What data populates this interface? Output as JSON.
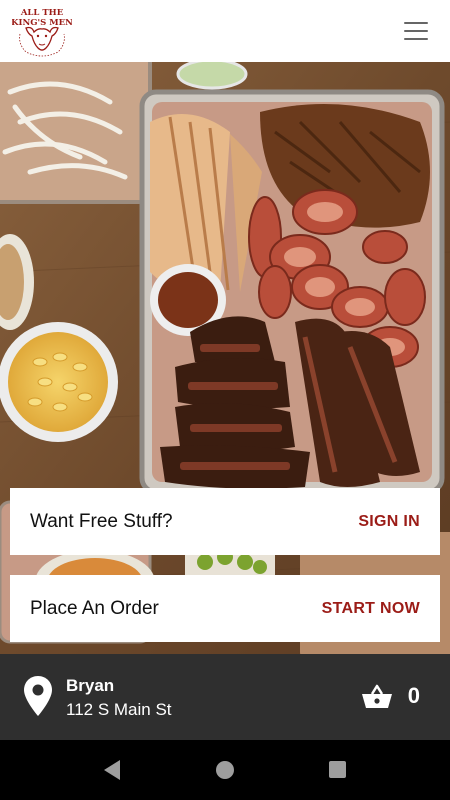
{
  "brand": {
    "logo_text_line1": "ALL THE",
    "logo_text_line2": "KING'S MEN",
    "accent_color": "#9b1c17"
  },
  "header": {
    "menu_icon": "hamburger-menu-icon"
  },
  "cards": [
    {
      "title": "Want Free Stuff?",
      "action": "SIGN IN"
    },
    {
      "title": "Place An Order",
      "action": "START NOW"
    }
  ],
  "location": {
    "icon": "location-pin-icon",
    "name": "Bryan",
    "address": "112 S Main St"
  },
  "cart": {
    "icon": "basket-icon",
    "count": "0"
  },
  "system_nav": {
    "back": "back-icon",
    "home": "home-icon",
    "recents": "recents-icon"
  }
}
